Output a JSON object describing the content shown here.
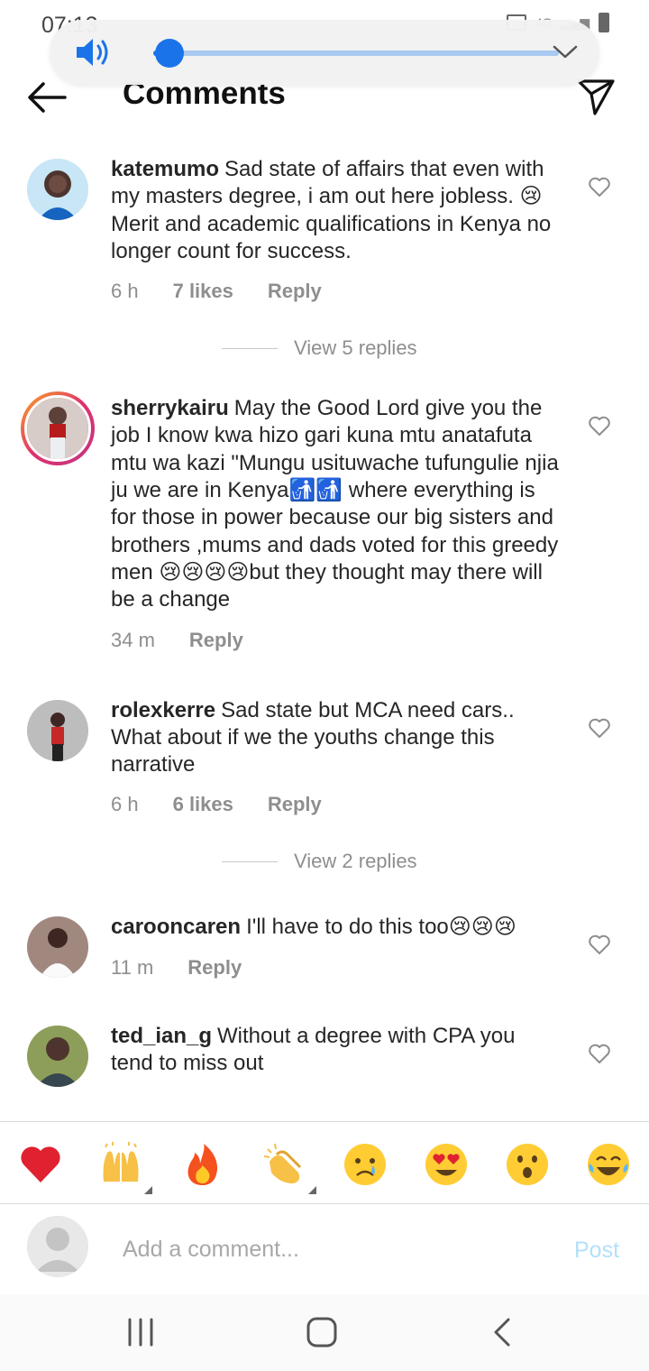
{
  "status_bar": {
    "time": "07:13",
    "network": "4G"
  },
  "volume": {
    "level": 0.04
  },
  "header": {
    "title": "Comments"
  },
  "comments": [
    {
      "username": "katemumo",
      "text": "Sad state of affairs that even with my masters degree, i am out here jobless. 😢 Merit and academic qualifications in Kenya no longer count for success.",
      "time": "6 h",
      "likes": "7 likes",
      "reply": "Reply",
      "view_replies": "View 5 replies"
    },
    {
      "username": "sherrykairu",
      "text": "May the Good Lord give you the job I know kwa hizo gari kuna mtu anatafuta mtu wa kazi \"Mungu usituwache tufungulie njia ju we are in Kenya🚮🚮 where everything  is for those in power because our big sisters and brothers ,mums and dads voted  for this greedy  men 😢😢😢😢but they thought  may there will be a change",
      "time": "34 m",
      "reply": "Reply"
    },
    {
      "username": "rolexkerre",
      "text": "Sad state but MCA  need cars.. What about if we the youths change this narrative",
      "time": "6 h",
      "likes": "6 likes",
      "reply": "Reply",
      "view_replies": "View 2 replies"
    },
    {
      "username": "carooncaren",
      "text": "I'll have to do this too😢😢😢",
      "time": "11 m",
      "reply": "Reply"
    },
    {
      "username": "ted_ian_g",
      "text": "Without a degree with CPA you tend to miss out"
    }
  ],
  "emoji_bar": [
    "❤️",
    "🙌",
    "🔥",
    "👏",
    "😢",
    "😍",
    "😮",
    "😂"
  ],
  "composer": {
    "placeholder": "Add a comment...",
    "post_label": "Post"
  },
  "colors": {
    "accent": "#1a73e8",
    "post_disabled": "#b2dffc",
    "like_red": "#ed4956"
  }
}
